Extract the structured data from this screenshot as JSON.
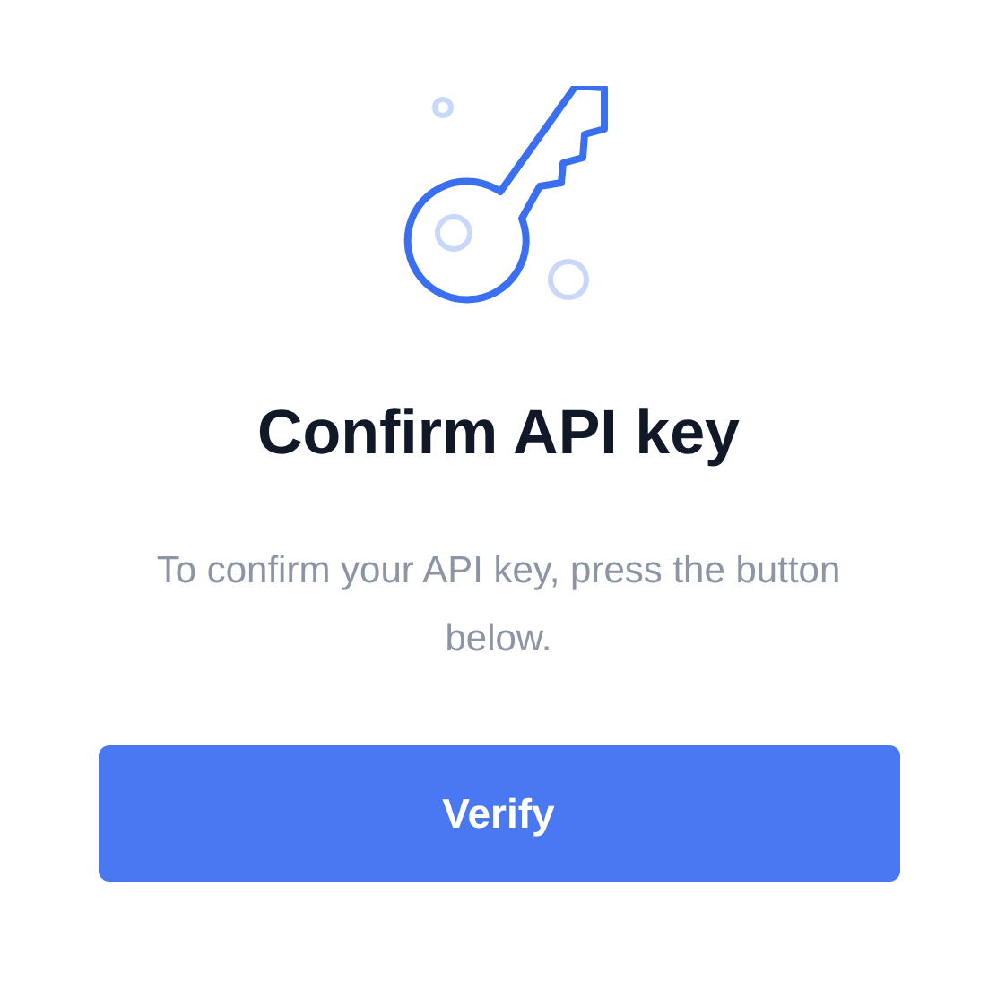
{
  "title": "Confirm API key",
  "description": "To confirm your API key, press the button below.",
  "button": {
    "label": "Verify"
  }
}
